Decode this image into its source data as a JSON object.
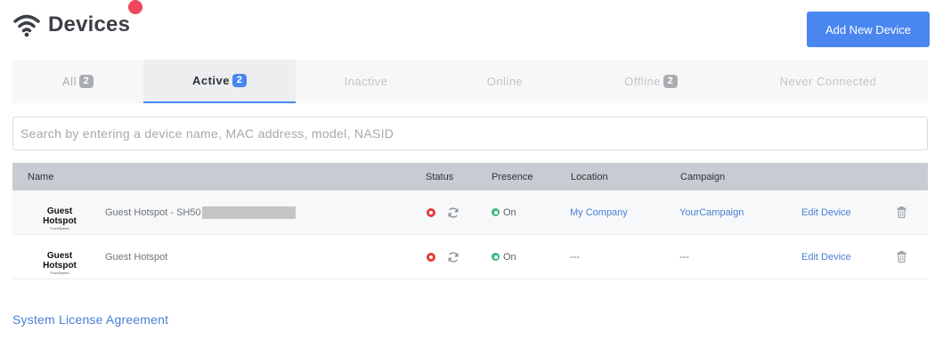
{
  "header": {
    "title": "Devices",
    "title_icon": "wifi-icon",
    "add_button_label": "Add New Device",
    "notification_color": "#f0475a"
  },
  "tabs": [
    {
      "label": "All",
      "count": "2",
      "active": false
    },
    {
      "label": "Active",
      "count": "2",
      "active": true
    },
    {
      "label": "Inactive",
      "count": null,
      "active": false
    },
    {
      "label": "Online",
      "count": null,
      "active": false
    },
    {
      "label": "Offline",
      "count": "2",
      "active": false
    },
    {
      "label": "Never Connected",
      "count": null,
      "active": false
    }
  ],
  "search": {
    "placeholder": "Search by entering a device name, MAC address, model, NASID",
    "value": ""
  },
  "table": {
    "columns": [
      "Name",
      "Status",
      "Presence",
      "Location",
      "Campaign"
    ],
    "rows": [
      {
        "logo_main": "Guest Hotspot",
        "logo_sub": "FromSpeed",
        "name": "Guest Hotspot - SH50",
        "redacted": true,
        "status": "red-dot",
        "presence": "On",
        "location": "My Company",
        "campaign": "YourCampaign",
        "edit_label": "Edit Device"
      },
      {
        "logo_main": "Guest Hotspot",
        "logo_sub": "FromSpeed",
        "name": "Guest Hotspot",
        "redacted": false,
        "status": "red-dot",
        "presence": "On",
        "location": "---",
        "campaign": "---",
        "edit_label": "Edit Device"
      }
    ]
  },
  "footer": {
    "license_link": "System License Agreement"
  },
  "colors": {
    "accent": "#4a86f0",
    "link": "#4a7fd6",
    "status_offline": "#e63a3a",
    "presence_on": "#3cb878"
  }
}
